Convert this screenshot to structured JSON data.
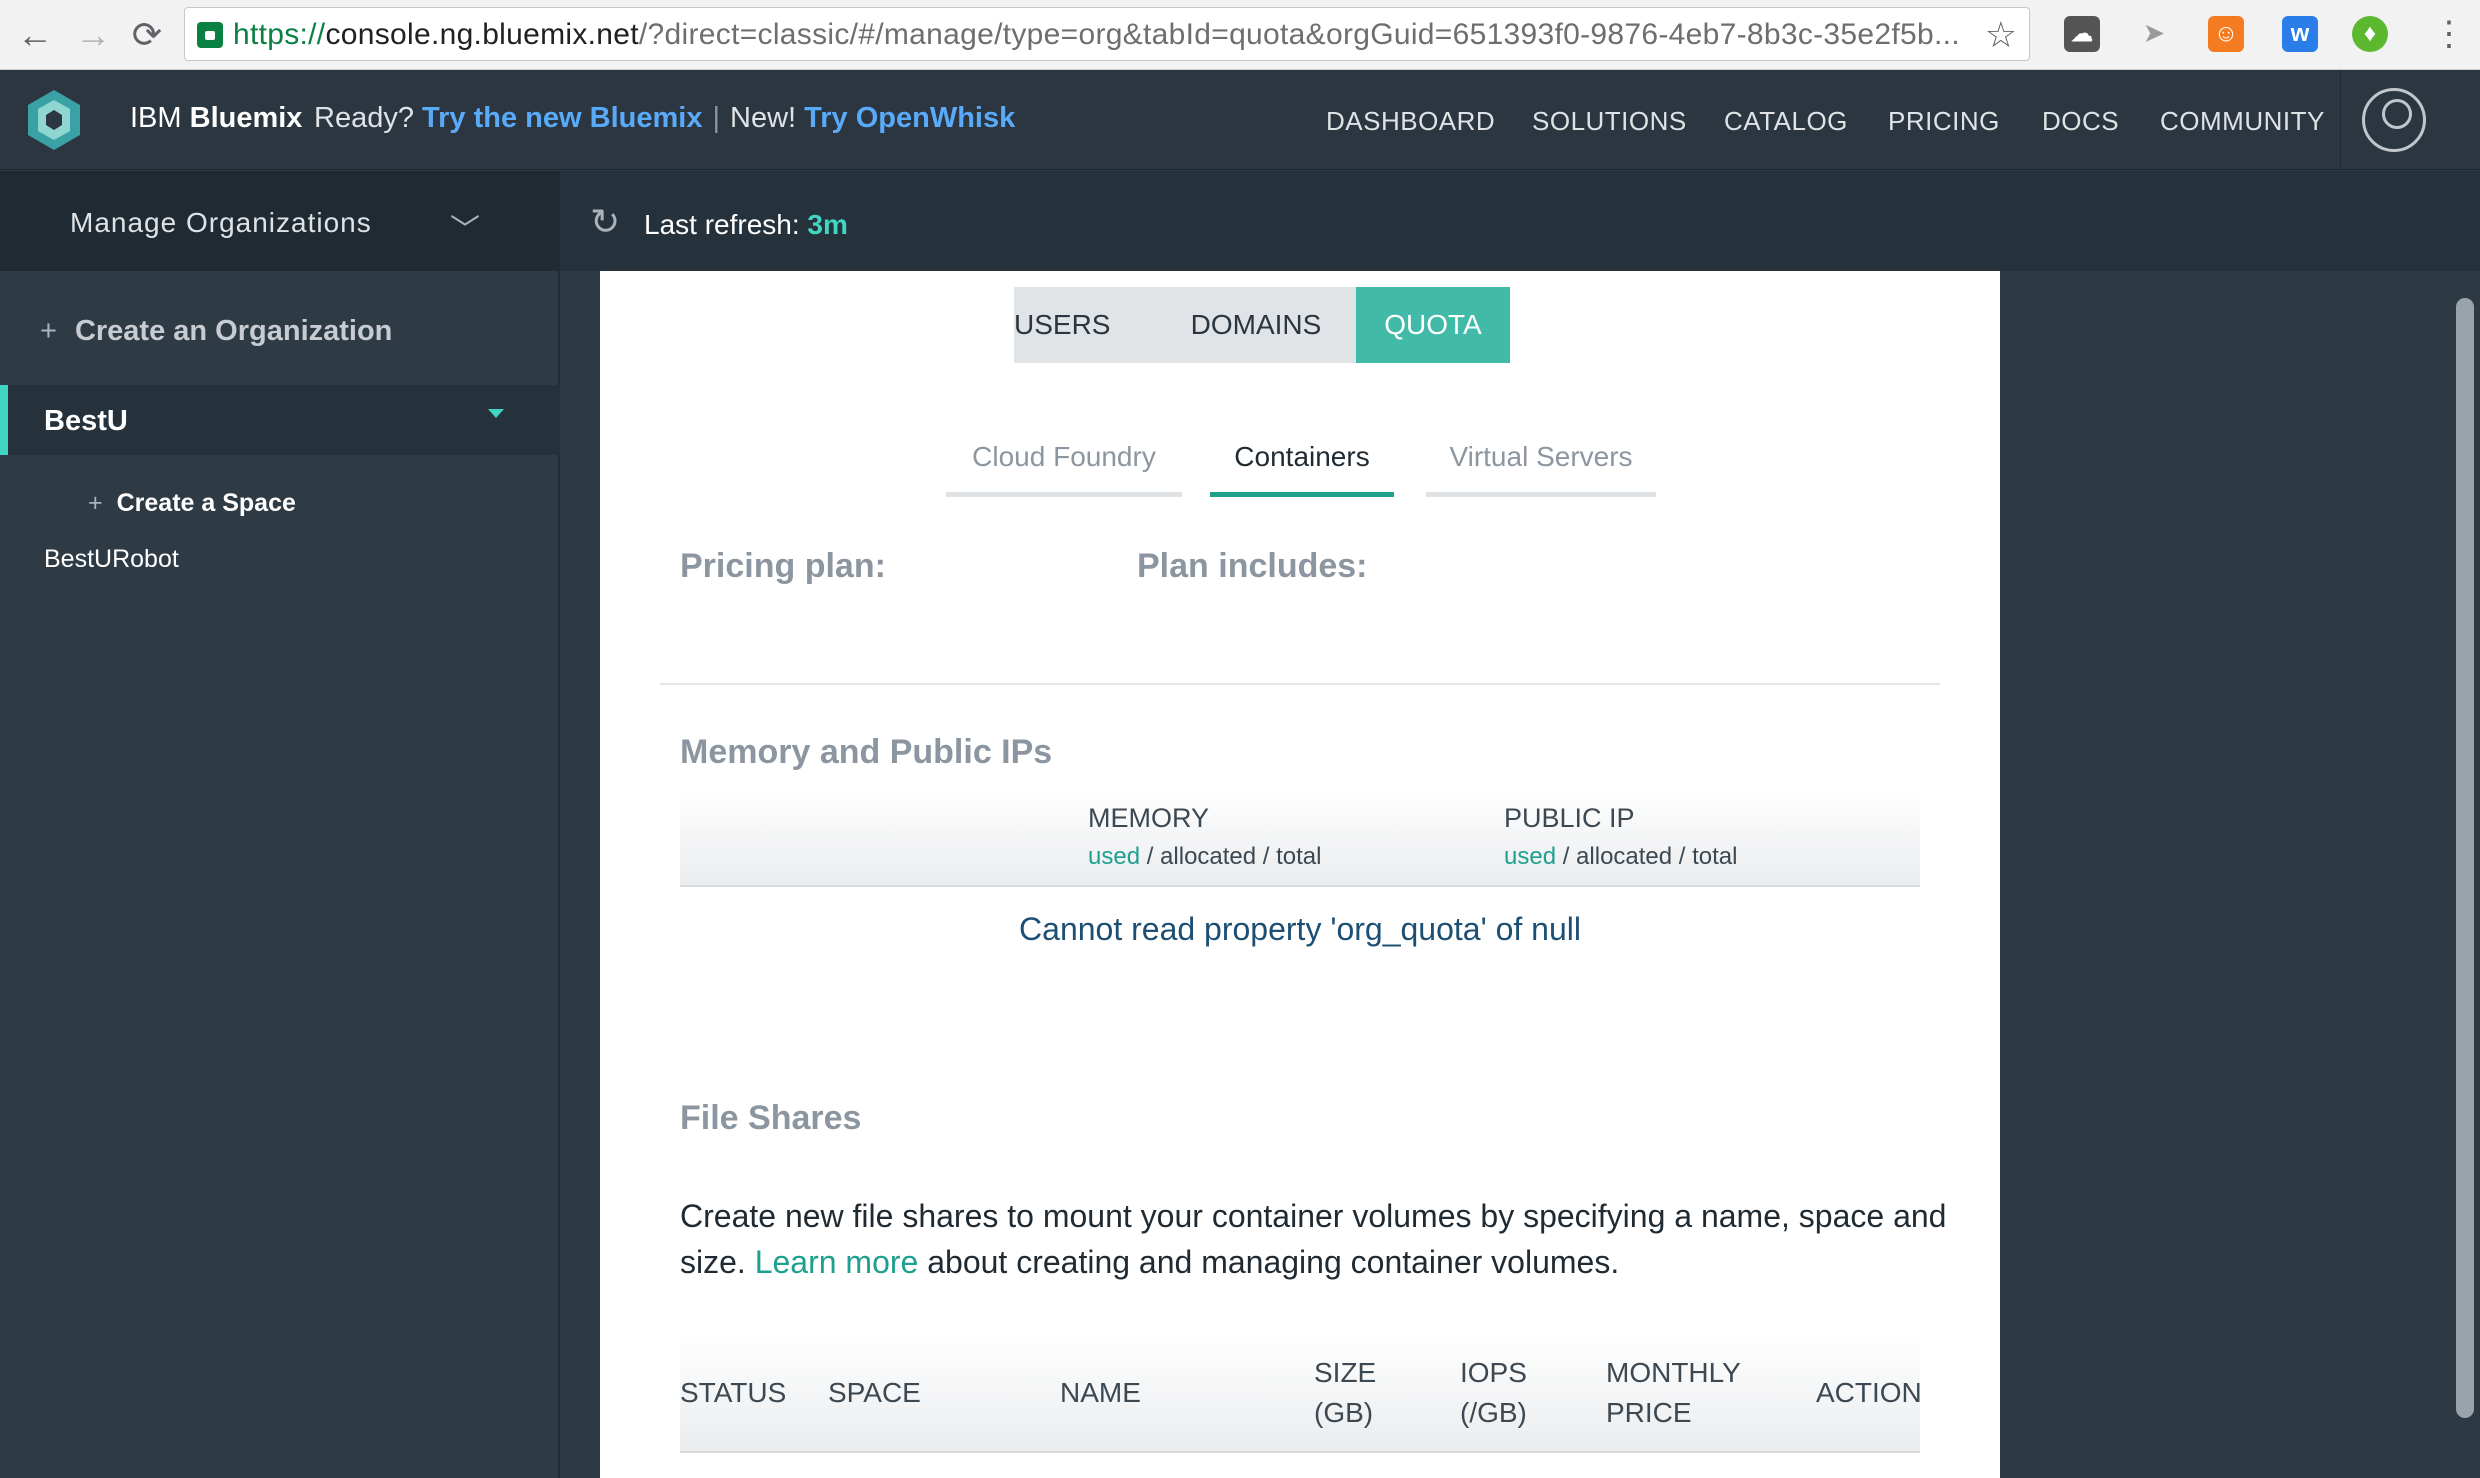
{
  "browser": {
    "url_scheme": "https://",
    "url_host": "console.ng.bluemix.net",
    "url_rest": "/?direct=classic/#/manage/type=org&tabId=quota&orgGuid=651393f0-9876-4eb7-8b3c-35e2f5b..."
  },
  "app": {
    "brand_prefix": "IBM ",
    "brand_name": "Bluemix",
    "promo_ready": "Ready?",
    "promo_ready_link": "Try the new Bluemix",
    "promo_new": "New!",
    "promo_new_link": "Try OpenWhisk",
    "accent_color": "#41bba8",
    "nav": [
      "DASHBOARD",
      "SOLUTIONS",
      "CATALOG",
      "PRICING",
      "DOCS",
      "COMMUNITY"
    ]
  },
  "subbar": {
    "manage_label": "Manage Organizations",
    "refresh_label": "Last refresh:",
    "refresh_value": "3m"
  },
  "sidebar": {
    "create_org": "Create an Organization",
    "org_name": "BestU",
    "create_space": "Create a Space",
    "spaces": [
      "BestURobot"
    ]
  },
  "main": {
    "tabs": [
      "USERS",
      "DOMAINS",
      "QUOTA"
    ],
    "active_tab": "QUOTA",
    "subtabs": [
      "Cloud Foundry",
      "Containers",
      "Virtual Servers"
    ],
    "active_subtab": "Containers",
    "pricing_plan_label": "Pricing plan:",
    "plan_includes_label": "Plan includes:",
    "memory_section_title": "Memory and Public IPs",
    "memory_col": "MEMORY",
    "public_ip_col": "PUBLIC IP",
    "used_word": "used",
    "usage_rest": " / allocated / total",
    "error_message": "Cannot read property 'org_quota' of null",
    "file_shares_title": "File Shares",
    "file_shares_desc_1": "Create new file shares to mount your container volumes by specifying a name, space and size.",
    "file_shares_link": "Learn more",
    "file_shares_desc_2": "about creating and managing container volumes.",
    "fs_columns": [
      "STATUS",
      "SPACE",
      "NAME",
      "SIZE (GB)",
      "IOPS (/GB)",
      "MONTHLY PRICE",
      "ACTION"
    ]
  }
}
